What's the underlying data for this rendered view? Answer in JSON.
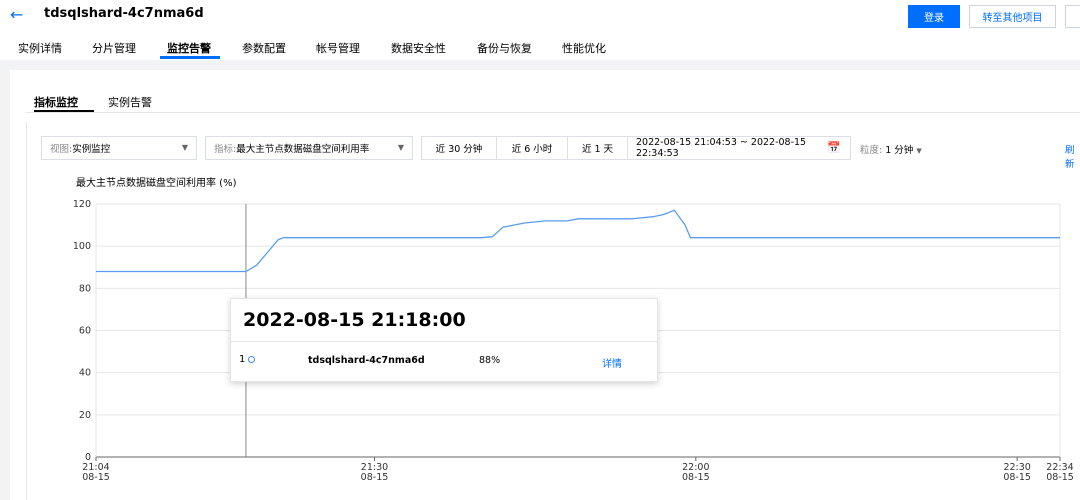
{
  "header": {
    "back_icon": "arrow-left-icon",
    "title": "tdsqlshard-4c7nma6d",
    "login_label": "登录",
    "transfer_label": "转至其他项目"
  },
  "tabs": [
    "实例详情",
    "分片管理",
    "监控告警",
    "参数配置",
    "帐号管理",
    "数据安全性",
    "备份与恢复",
    "性能优化"
  ],
  "active_tab": "监控告警",
  "subtabs": [
    "指标监控",
    "实例告警"
  ],
  "toolbar": {
    "view_prefix": "视图:",
    "view_value": "实例监控",
    "metric_prefix": "指标:",
    "metric_value": "最大主节点数据磁盘空间利用率",
    "quick_ranges": [
      "近 30 分钟",
      "近 6 小时",
      "近 1 天"
    ],
    "date_range": "2022-08-15 21:04:53 ~ 2022-08-15 22:34:53",
    "granularity_prefix": "粒度:",
    "granularity_value": "1 分钟",
    "refresh_label": "刷新"
  },
  "chart_data": {
    "type": "line",
    "title": "最大主节点数据磁盘空间利用率 (%)",
    "ylim": [
      0,
      120
    ],
    "y_ticks": [
      0,
      20,
      40,
      60,
      80,
      100,
      120
    ],
    "x_ticks": [
      {
        "t": 0,
        "label": "21:04",
        "date": "08-15"
      },
      {
        "t": 26,
        "label": "21:30",
        "date": "08-15"
      },
      {
        "t": 56,
        "label": "22:00",
        "date": "08-15"
      },
      {
        "t": 86,
        "label": "22:30",
        "date": "08-15"
      },
      {
        "t": 90,
        "label": "22:34",
        "date": "08-15"
      }
    ],
    "x_unit": "minutes since 21:04",
    "grid": true,
    "series": [
      {
        "name": "tdsqlshard-4c7nma6d",
        "color": "#5b9cf2",
        "points": [
          [
            0,
            88
          ],
          [
            14,
            88
          ],
          [
            15,
            91
          ],
          [
            16,
            97
          ],
          [
            17,
            103
          ],
          [
            17.5,
            104
          ],
          [
            18,
            104
          ],
          [
            36,
            104
          ],
          [
            37,
            104.5
          ],
          [
            38,
            109
          ],
          [
            39,
            110
          ],
          [
            40,
            111
          ],
          [
            42,
            112
          ],
          [
            44,
            112
          ],
          [
            45,
            113
          ],
          [
            50,
            113
          ],
          [
            52,
            114
          ],
          [
            53,
            115
          ],
          [
            54,
            117
          ],
          [
            55,
            110
          ],
          [
            55.5,
            104
          ],
          [
            56,
            104
          ],
          [
            90,
            104
          ]
        ]
      }
    ]
  },
  "tooltip": {
    "time": "2022-08-15 21:18:00",
    "index": "1",
    "name": "tdsqlshard-4c7nma6d",
    "value": "88%",
    "link": "详情"
  }
}
